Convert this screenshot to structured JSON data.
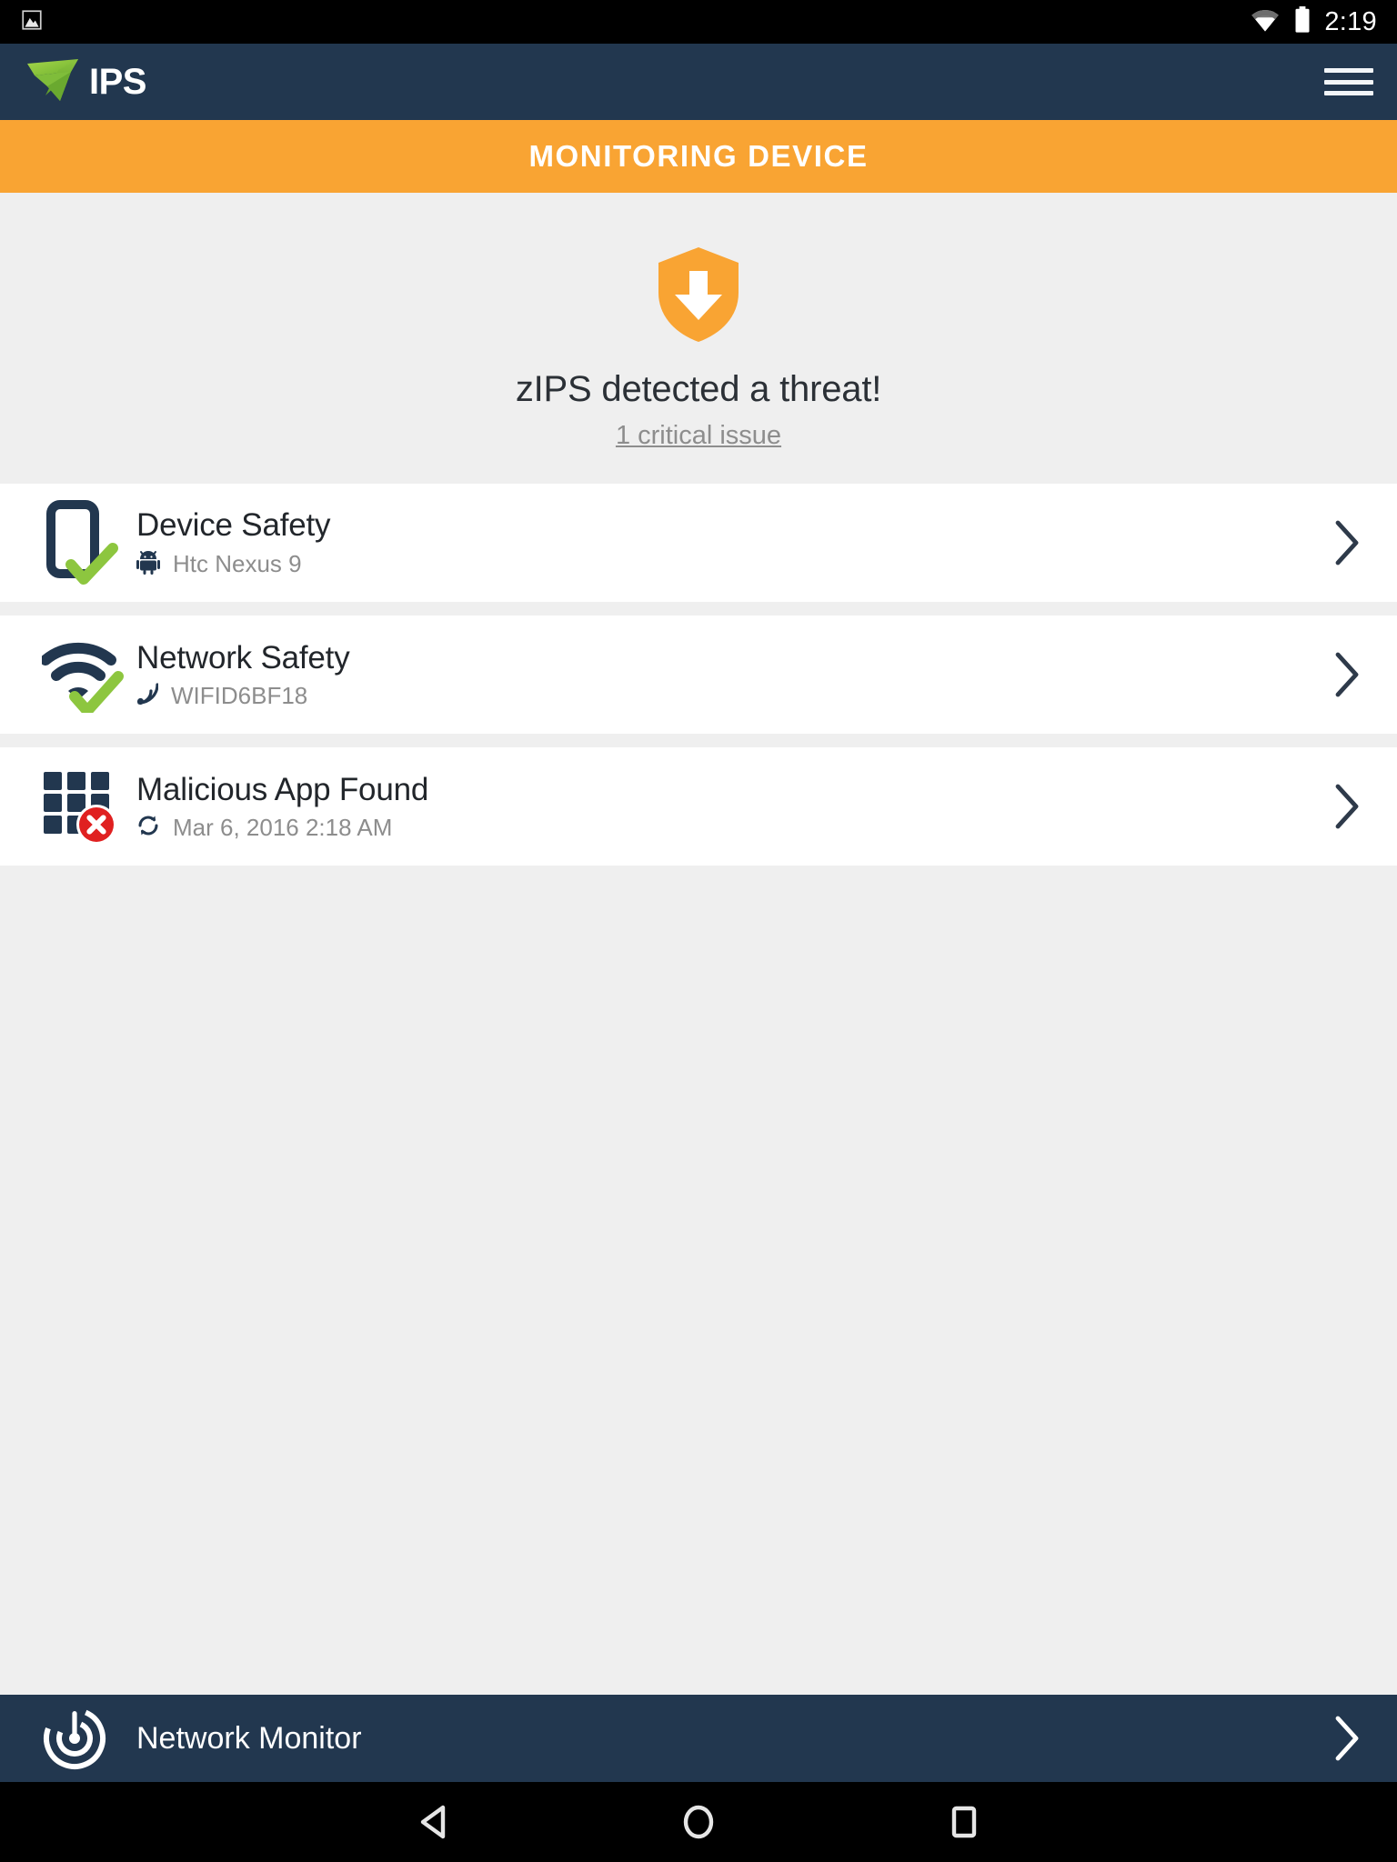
{
  "statusbar": {
    "time": "2:19",
    "icons": [
      "image-icon",
      "wifi-icon",
      "battery-icon"
    ]
  },
  "appbar": {
    "logo_mark": "zips-z-logo-icon",
    "logo_text": "IPS",
    "menu_label": "hamburger-menu-icon"
  },
  "banner": {
    "title": "MONITORING DEVICE",
    "color": "#f9a433"
  },
  "hero": {
    "icon": "shield-download-icon",
    "icon_color": "#f9a433",
    "title": "zIPS detected a threat!",
    "subtitle": "1 critical issue"
  },
  "cards": [
    {
      "icon": "phone-check-icon",
      "status_color": "#8dc63f",
      "title": "Device Safety",
      "meta_icon": "android-robot-icon",
      "meta": "Htc Nexus 9",
      "chevron": "chevron-right-icon"
    },
    {
      "icon": "wifi-check-icon",
      "status_color": "#8dc63f",
      "title": "Network Safety",
      "meta_icon": "rss-signal-icon",
      "meta": "WIFID6BF18",
      "chevron": "chevron-right-icon"
    },
    {
      "icon": "app-grid-error-icon",
      "status_color": "#e02020",
      "title": "Malicious App Found",
      "meta_icon": "refresh-icon",
      "meta": "Mar 6, 2016 2:18 AM",
      "chevron": "chevron-right-icon"
    }
  ],
  "bottombar": {
    "icon": "radar-target-icon",
    "label": "Network Monitor",
    "chevron": "chevron-right-icon"
  },
  "navbar": {
    "back": "back-triangle-icon",
    "home": "home-circle-icon",
    "recents": "recents-square-icon"
  },
  "colors": {
    "navy": "#22374f",
    "orange": "#f9a433",
    "green": "#8dc63f",
    "red": "#e02020",
    "page_bg": "#efefef",
    "card_bg": "#ffffff"
  }
}
